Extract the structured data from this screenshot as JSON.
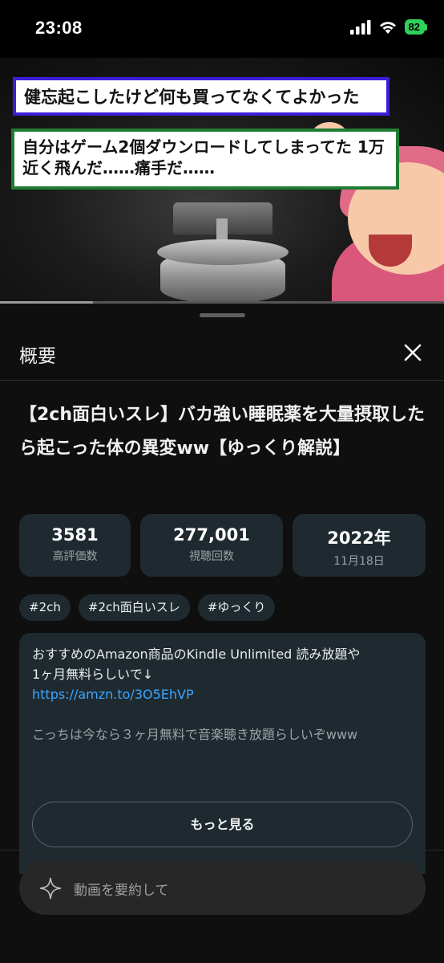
{
  "status_bar": {
    "time": "23:08",
    "battery": "82"
  },
  "video": {
    "caption_1": "健忘起こしたけど何も買ってなくてよかった",
    "caption_2": "自分はゲーム2個ダウンロードしてしまってた 1万近く飛んだ……痛手だ……",
    "progress": 0.21
  },
  "sheet": {
    "title": "概要",
    "video_title": "【2ch面白いスレ】バカ強い睡眠薬を大量摂取したら起こった体の異変ww【ゆっくり解説】"
  },
  "stats": [
    {
      "value": "3581",
      "label": "高評価数"
    },
    {
      "value": "277,001",
      "label": "視聴回数"
    },
    {
      "value": "2022年",
      "label": "11月18日"
    }
  ],
  "tags": [
    "#2ch",
    "#2ch面白いスレ",
    "#ゆっくり"
  ],
  "description": {
    "line1": "おすすめのAmazon商品のKindle Unlimited 読み放題や",
    "line2": "1ヶ月無料らしいで↓",
    "link": "https://amzn.to/3O5EhVP",
    "line3": "こっちは今なら３ヶ月無料で音楽聴き放題らしいぞwww",
    "more_label": "もっと見る"
  },
  "ask": {
    "placeholder": "動画を要約して"
  },
  "colors": {
    "link": "#3ea6ff",
    "card": "#1e2a30",
    "battery": "#30d158"
  }
}
